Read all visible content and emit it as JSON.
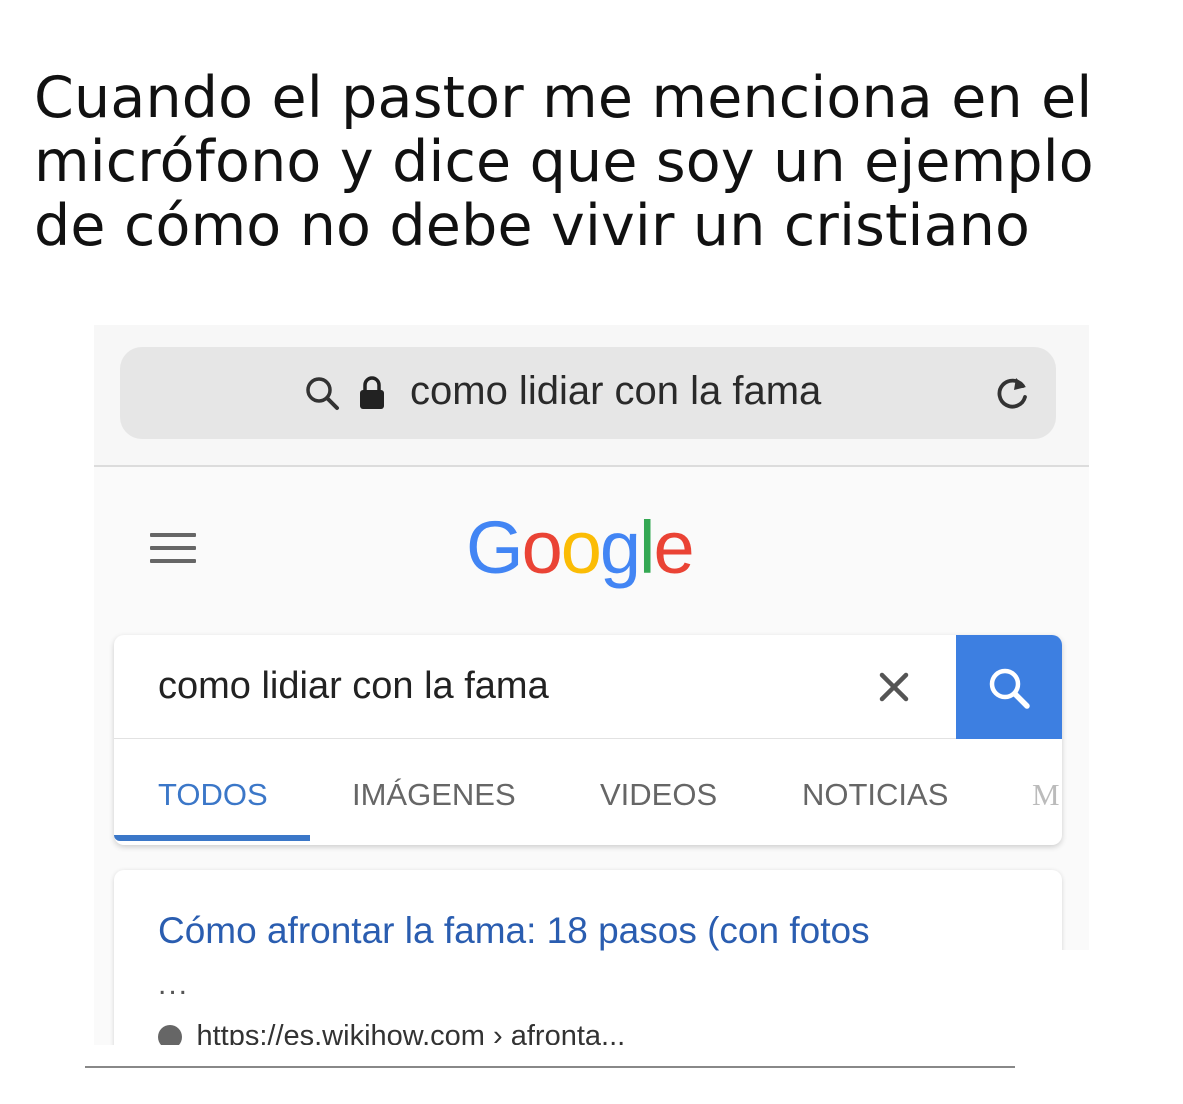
{
  "caption": {
    "line1": "Cuando el pastor me menciona en el",
    "line2": "micrófono y dice que soy un ejemplo",
    "line3": "de cómo no debe vivir un cristiano"
  },
  "browser": {
    "address_text": "como lidiar con la fama",
    "icons": [
      "search-icon",
      "lock-icon",
      "reload-icon"
    ]
  },
  "google": {
    "logo": [
      "G",
      "o",
      "o",
      "g",
      "l",
      "e"
    ],
    "logo_colors": [
      "#4285F4",
      "#EA4335",
      "#FBBC05",
      "#4285F4",
      "#34A853",
      "#EA4335"
    ],
    "search_value": "como lidiar con la fama",
    "tabs": [
      {
        "label": "TODOS",
        "active": true
      },
      {
        "label": "IMÁGENES",
        "active": false
      },
      {
        "label": "VIDEOS",
        "active": false
      },
      {
        "label": "NOTICIAS",
        "active": false
      },
      {
        "label": "M",
        "active": false
      }
    ]
  },
  "result": {
    "title": "Cómo afrontar la fama: 18 pasos (con fotos",
    "ellipsis": "...",
    "url": "https://es.wikihow.com › afronta..."
  },
  "colors": {
    "accent_blue": "#3d7fe1",
    "link_blue": "#2a5db0",
    "tab_active": "#3b77c8"
  }
}
